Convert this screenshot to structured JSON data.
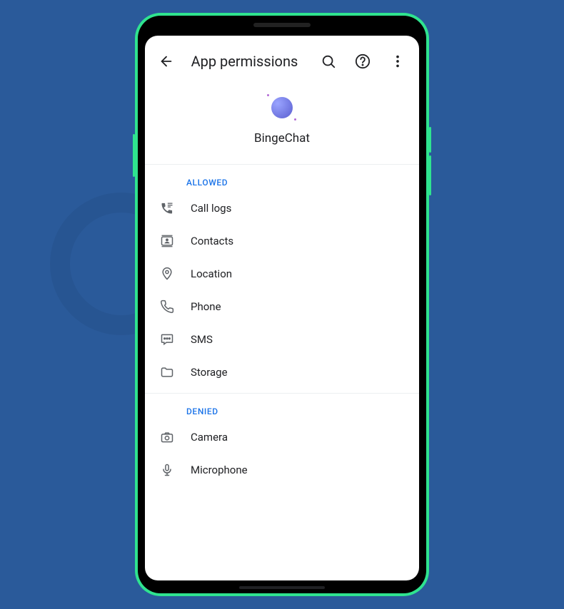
{
  "header": {
    "title": "App permissions"
  },
  "app": {
    "name": "BingeChat"
  },
  "sections": {
    "allowed": {
      "label": "ALLOWED",
      "items": [
        {
          "label": "Call logs",
          "icon": "call-log-icon"
        },
        {
          "label": "Contacts",
          "icon": "contacts-icon"
        },
        {
          "label": "Location",
          "icon": "location-icon"
        },
        {
          "label": "Phone",
          "icon": "phone-icon"
        },
        {
          "label": "SMS",
          "icon": "sms-icon"
        },
        {
          "label": "Storage",
          "icon": "storage-icon"
        }
      ]
    },
    "denied": {
      "label": "DENIED",
      "items": [
        {
          "label": "Camera",
          "icon": "camera-icon"
        },
        {
          "label": "Microphone",
          "icon": "microphone-icon"
        }
      ]
    }
  }
}
